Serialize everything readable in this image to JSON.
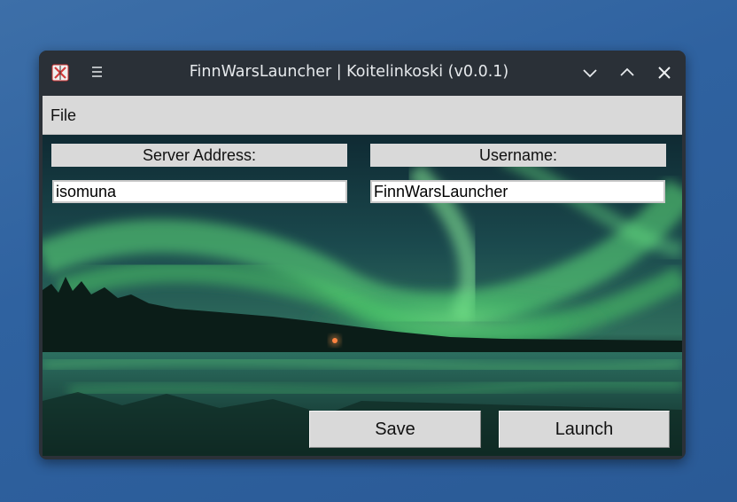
{
  "window": {
    "title": "FinnWarsLauncher | Koitelinkoski (v0.0.1)",
    "icons": {
      "app": "app-logo-icon",
      "menu": "hamburger-menu-icon",
      "minimize": "chevron-down-icon",
      "maximize": "chevron-up-icon",
      "close": "close-icon"
    }
  },
  "menubar": {
    "file_label": "File"
  },
  "form": {
    "server_label": "Server Address:",
    "server_value": "isomuna",
    "username_label": "Username:",
    "username_value": "FinnWarsLauncher"
  },
  "buttons": {
    "save_label": "Save",
    "launch_label": "Launch"
  },
  "colors": {
    "desktop": "#2f62a0",
    "titlebar": "#2a3037",
    "widget_gray": "#d9d9d9",
    "aurora_green": "#4fd06a"
  }
}
